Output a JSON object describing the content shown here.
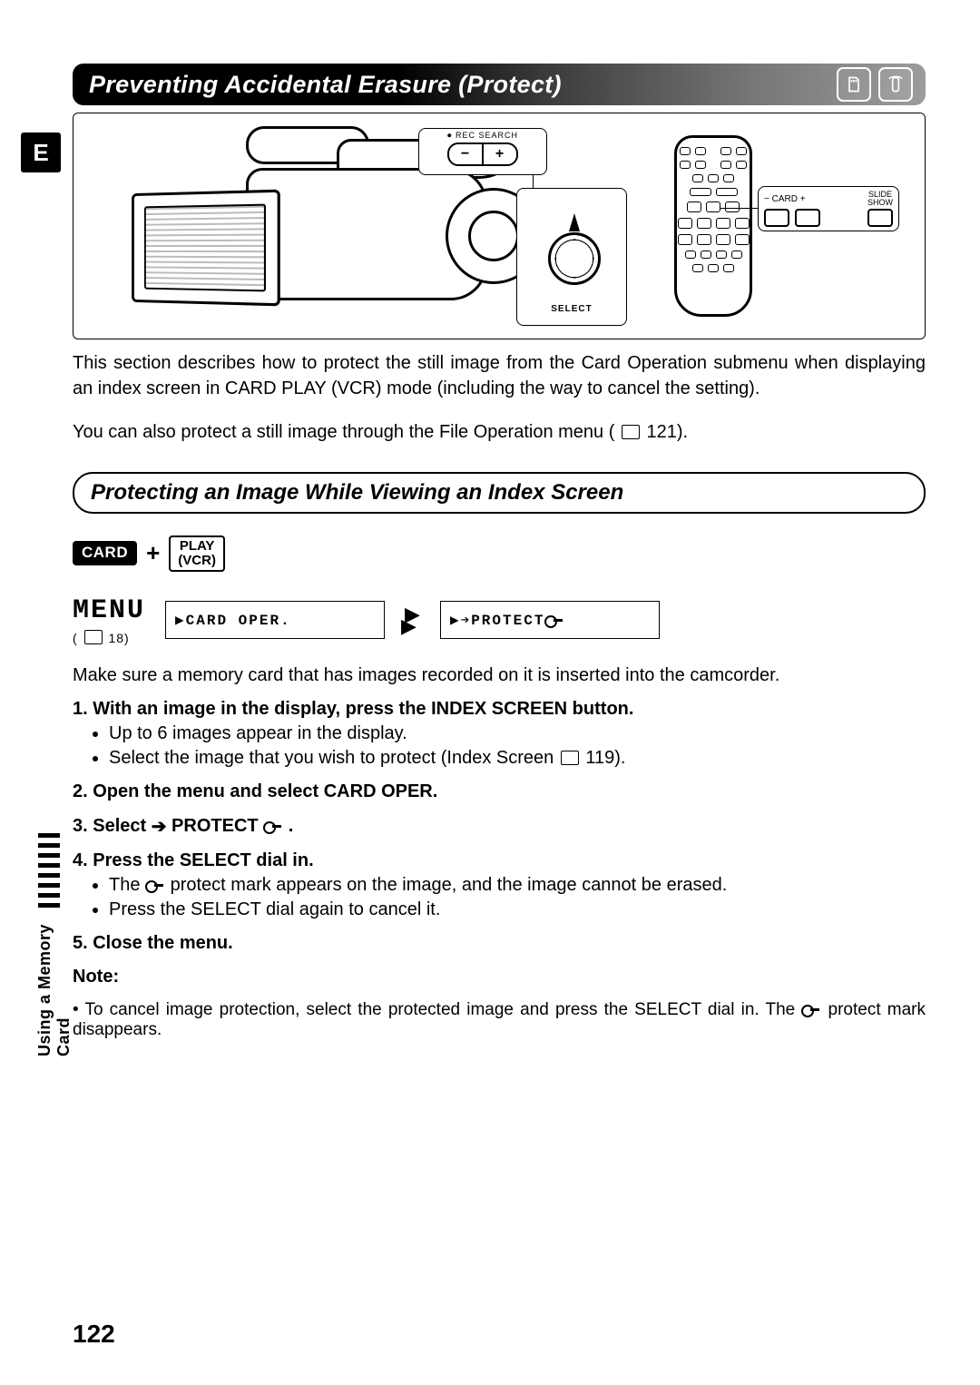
{
  "lang_tag": "E",
  "title": "Preventing Accidental Erasure (Protect)",
  "side_label": "Using a Memory Card",
  "page_number": "122",
  "illus": {
    "rec_search": "REC SEARCH",
    "minus": "−",
    "plus": "+",
    "select_label": "SELECT",
    "card_minus": "− CARD +",
    "slide_show": "SLIDE\nSHOW"
  },
  "intro_p1": "This section describes how to protect the still image from the Card Operation submenu when displaying an index screen in CARD PLAY (VCR) mode (including the way to cancel the setting).",
  "intro_p2_a": "You can also protect a still image through the File Operation menu (",
  "intro_p2_page": "121).",
  "subheader": "Protecting an Image While Viewing an Index Screen",
  "mode": {
    "card": "CARD",
    "plus": "+",
    "play": "PLAY",
    "vcr": "(VCR)"
  },
  "menu": {
    "label": "MENU",
    "ref_page": "18)",
    "item1": "▶CARD OPER.",
    "item2": "▶➔PROTECT"
  },
  "pre_steps": "Make sure a memory card that has images recorded on it is inserted into the camcorder.",
  "steps": {
    "s1": "1. With an image in the display, press the INDEX SCREEN button.",
    "s1a": "Up to 6 images appear in the display.",
    "s1b_a": "Select the image that you wish to protect (Index Screen ",
    "s1b_page": "119).",
    "s2": "2. Open the menu and select CARD OPER.",
    "s3_a": "3. Select ",
    "s3_b": " PROTECT ",
    "s3_c": " .",
    "s4": "4. Press the SELECT dial in.",
    "s4a_a": "The ",
    "s4a_b": " protect mark appears on the image, and the image cannot be erased.",
    "s4b": "Press the SELECT dial again to cancel it.",
    "s5": "5. Close the menu."
  },
  "note": {
    "heading": "Note:",
    "body_a": "• To cancel image protection, select the protected image and press the SELECT dial in. The ",
    "body_b": " protect mark disappears."
  }
}
